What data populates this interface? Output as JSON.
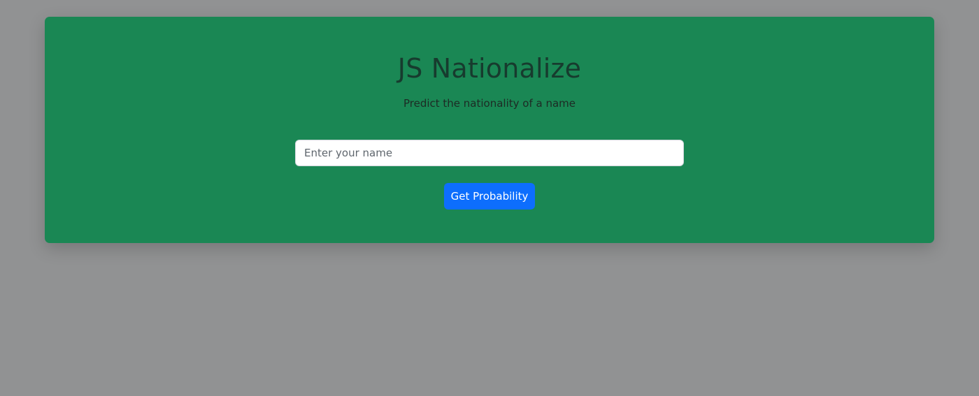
{
  "app": {
    "title": "JS Nationalize",
    "subtitle": "Predict the nationality of a name"
  },
  "form": {
    "name_input": {
      "value": "",
      "placeholder": "Enter your name"
    },
    "submit_label": "Get Probability"
  },
  "colors": {
    "page_background": "#919293",
    "card_background": "#1a8754",
    "title_text": "#173b2e",
    "button_primary": "#0d6efd",
    "button_text": "#ffffff"
  }
}
